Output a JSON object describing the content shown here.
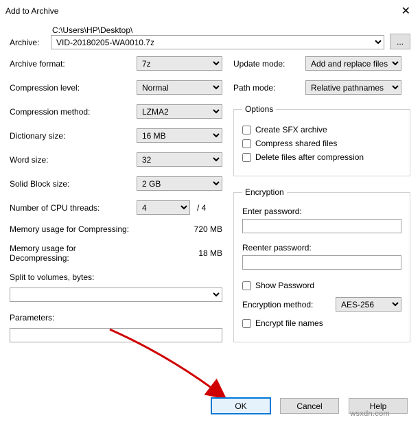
{
  "titlebar": {
    "title": "Add to Archive"
  },
  "archive": {
    "label": "Archive:",
    "path": "C:\\Users\\HP\\Desktop\\",
    "filename": "VID-20180205-WA0010.7z",
    "browse": "..."
  },
  "left": {
    "format_label": "Archive format:",
    "format": "7z",
    "level_label": "Compression level:",
    "level": "Normal",
    "method_label": "Compression method:",
    "method": "LZMA2",
    "dict_label": "Dictionary size:",
    "dict": "16 MB",
    "word_label": "Word size:",
    "word": "32",
    "block_label": "Solid Block size:",
    "block": "2 GB",
    "threads_label": "Number of CPU threads:",
    "threads": "4",
    "threads_total": "/ 4",
    "mem_comp_label": "Memory usage for Compressing:",
    "mem_comp": "720 MB",
    "mem_decomp_label": "Memory usage for Decompressing:",
    "mem_decomp": "18 MB",
    "split_label": "Split to volumes, bytes:",
    "split_value": "",
    "params_label": "Parameters:",
    "params_value": ""
  },
  "right": {
    "update_label": "Update mode:",
    "update": "Add and replace files",
    "path_label": "Path mode:",
    "path": "Relative pathnames",
    "options_legend": "Options",
    "sfx": "Create SFX archive",
    "shared": "Compress shared files",
    "delete_after": "Delete files after compression",
    "enc_legend": "Encryption",
    "enter_pw": "Enter password:",
    "reenter_pw": "Reenter password:",
    "show_pw": "Show Password",
    "enc_method_label": "Encryption method:",
    "enc_method": "AES-256",
    "encrypt_names": "Encrypt file names"
  },
  "buttons": {
    "ok": "OK",
    "cancel": "Cancel",
    "help": "Help"
  },
  "watermark": "wsxdn.com"
}
